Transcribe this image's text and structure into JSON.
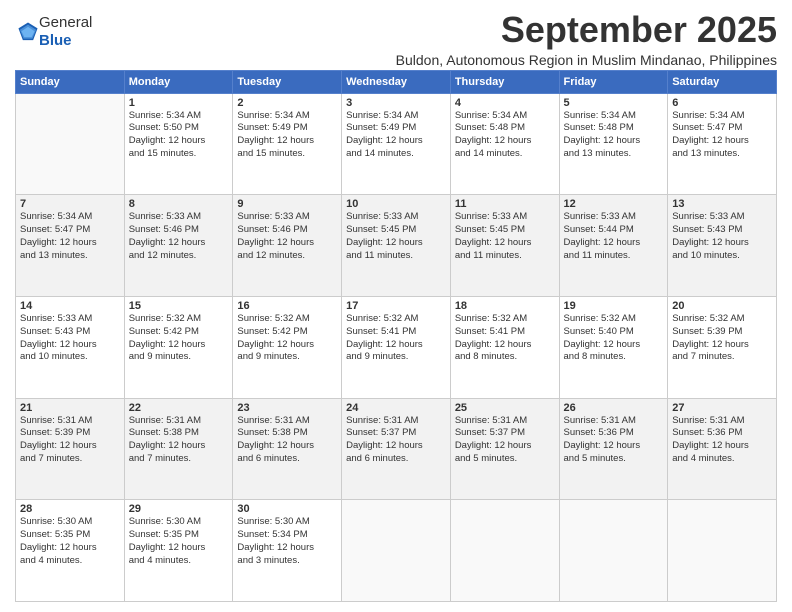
{
  "header": {
    "logo_line1": "General",
    "logo_line2": "Blue",
    "month_title": "September 2025",
    "location": "Buldon, Autonomous Region in Muslim Mindanao, Philippines"
  },
  "weekdays": [
    "Sunday",
    "Monday",
    "Tuesday",
    "Wednesday",
    "Thursday",
    "Friday",
    "Saturday"
  ],
  "weeks": [
    [
      {
        "day": "",
        "info": ""
      },
      {
        "day": "1",
        "info": "Sunrise: 5:34 AM\nSunset: 5:50 PM\nDaylight: 12 hours\nand 15 minutes."
      },
      {
        "day": "2",
        "info": "Sunrise: 5:34 AM\nSunset: 5:49 PM\nDaylight: 12 hours\nand 15 minutes."
      },
      {
        "day": "3",
        "info": "Sunrise: 5:34 AM\nSunset: 5:49 PM\nDaylight: 12 hours\nand 14 minutes."
      },
      {
        "day": "4",
        "info": "Sunrise: 5:34 AM\nSunset: 5:48 PM\nDaylight: 12 hours\nand 14 minutes."
      },
      {
        "day": "5",
        "info": "Sunrise: 5:34 AM\nSunset: 5:48 PM\nDaylight: 12 hours\nand 13 minutes."
      },
      {
        "day": "6",
        "info": "Sunrise: 5:34 AM\nSunset: 5:47 PM\nDaylight: 12 hours\nand 13 minutes."
      }
    ],
    [
      {
        "day": "7",
        "info": "Sunrise: 5:34 AM\nSunset: 5:47 PM\nDaylight: 12 hours\nand 13 minutes."
      },
      {
        "day": "8",
        "info": "Sunrise: 5:33 AM\nSunset: 5:46 PM\nDaylight: 12 hours\nand 12 minutes."
      },
      {
        "day": "9",
        "info": "Sunrise: 5:33 AM\nSunset: 5:46 PM\nDaylight: 12 hours\nand 12 minutes."
      },
      {
        "day": "10",
        "info": "Sunrise: 5:33 AM\nSunset: 5:45 PM\nDaylight: 12 hours\nand 11 minutes."
      },
      {
        "day": "11",
        "info": "Sunrise: 5:33 AM\nSunset: 5:45 PM\nDaylight: 12 hours\nand 11 minutes."
      },
      {
        "day": "12",
        "info": "Sunrise: 5:33 AM\nSunset: 5:44 PM\nDaylight: 12 hours\nand 11 minutes."
      },
      {
        "day": "13",
        "info": "Sunrise: 5:33 AM\nSunset: 5:43 PM\nDaylight: 12 hours\nand 10 minutes."
      }
    ],
    [
      {
        "day": "14",
        "info": "Sunrise: 5:33 AM\nSunset: 5:43 PM\nDaylight: 12 hours\nand 10 minutes."
      },
      {
        "day": "15",
        "info": "Sunrise: 5:32 AM\nSunset: 5:42 PM\nDaylight: 12 hours\nand 9 minutes."
      },
      {
        "day": "16",
        "info": "Sunrise: 5:32 AM\nSunset: 5:42 PM\nDaylight: 12 hours\nand 9 minutes."
      },
      {
        "day": "17",
        "info": "Sunrise: 5:32 AM\nSunset: 5:41 PM\nDaylight: 12 hours\nand 9 minutes."
      },
      {
        "day": "18",
        "info": "Sunrise: 5:32 AM\nSunset: 5:41 PM\nDaylight: 12 hours\nand 8 minutes."
      },
      {
        "day": "19",
        "info": "Sunrise: 5:32 AM\nSunset: 5:40 PM\nDaylight: 12 hours\nand 8 minutes."
      },
      {
        "day": "20",
        "info": "Sunrise: 5:32 AM\nSunset: 5:39 PM\nDaylight: 12 hours\nand 7 minutes."
      }
    ],
    [
      {
        "day": "21",
        "info": "Sunrise: 5:31 AM\nSunset: 5:39 PM\nDaylight: 12 hours\nand 7 minutes."
      },
      {
        "day": "22",
        "info": "Sunrise: 5:31 AM\nSunset: 5:38 PM\nDaylight: 12 hours\nand 7 minutes."
      },
      {
        "day": "23",
        "info": "Sunrise: 5:31 AM\nSunset: 5:38 PM\nDaylight: 12 hours\nand 6 minutes."
      },
      {
        "day": "24",
        "info": "Sunrise: 5:31 AM\nSunset: 5:37 PM\nDaylight: 12 hours\nand 6 minutes."
      },
      {
        "day": "25",
        "info": "Sunrise: 5:31 AM\nSunset: 5:37 PM\nDaylight: 12 hours\nand 5 minutes."
      },
      {
        "day": "26",
        "info": "Sunrise: 5:31 AM\nSunset: 5:36 PM\nDaylight: 12 hours\nand 5 minutes."
      },
      {
        "day": "27",
        "info": "Sunrise: 5:31 AM\nSunset: 5:36 PM\nDaylight: 12 hours\nand 4 minutes."
      }
    ],
    [
      {
        "day": "28",
        "info": "Sunrise: 5:30 AM\nSunset: 5:35 PM\nDaylight: 12 hours\nand 4 minutes."
      },
      {
        "day": "29",
        "info": "Sunrise: 5:30 AM\nSunset: 5:35 PM\nDaylight: 12 hours\nand 4 minutes."
      },
      {
        "day": "30",
        "info": "Sunrise: 5:30 AM\nSunset: 5:34 PM\nDaylight: 12 hours\nand 3 minutes."
      },
      {
        "day": "",
        "info": ""
      },
      {
        "day": "",
        "info": ""
      },
      {
        "day": "",
        "info": ""
      },
      {
        "day": "",
        "info": ""
      }
    ]
  ]
}
